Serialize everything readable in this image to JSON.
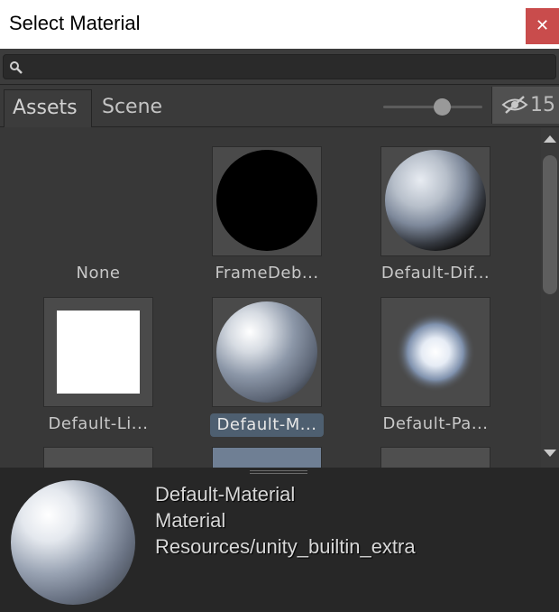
{
  "window": {
    "title": "Select Material",
    "close_label": "✕"
  },
  "search": {
    "value": "",
    "placeholder": ""
  },
  "tabs": [
    {
      "label": "Assets",
      "active": true
    },
    {
      "label": "Scene",
      "active": false
    }
  ],
  "zoom_slider": {
    "level": 0.6
  },
  "hidden_count": {
    "label": "15",
    "icon": "eye-slash-icon"
  },
  "grid": {
    "items": [
      {
        "label": "None",
        "kind": "none"
      },
      {
        "label": "FrameDeb...",
        "kind": "black-sphere"
      },
      {
        "label": "Default-Dif...",
        "kind": "diffuse-sphere"
      },
      {
        "label": "Default-Li...",
        "kind": "white-square"
      },
      {
        "label": "Default-M...",
        "kind": "material-sphere",
        "selected": true
      },
      {
        "label": "Default-Pa...",
        "kind": "particle"
      }
    ]
  },
  "preview": {
    "name": "Default-Material",
    "type": "Material",
    "path": "Resources/unity_builtin_extra"
  },
  "colors": {
    "close": "#c94c4c",
    "selection": "#4e5f70",
    "background": "#383838",
    "preview_bg": "#272727"
  }
}
